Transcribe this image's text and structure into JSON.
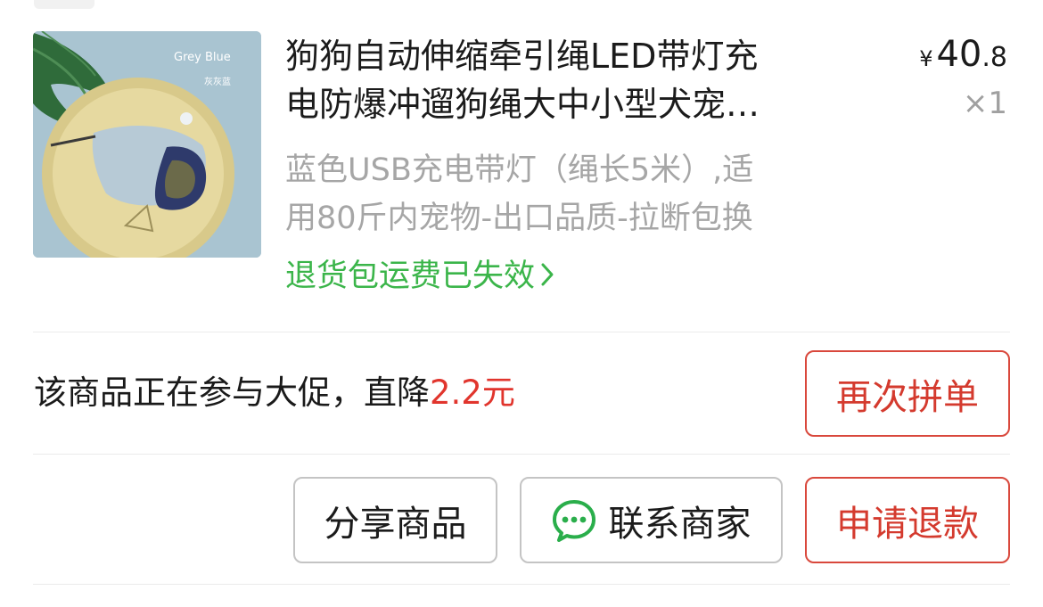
{
  "product": {
    "title_line1": "狗狗自动伸缩牵引绳LED带灯充",
    "title_line2": "电防爆冲遛狗绳大中小型犬宠…",
    "price_symbol": "¥",
    "price_int": "40",
    "price_dec": ".8",
    "quantity": "×1",
    "spec_line1": "蓝色USB充电带灯（绳长5米）,适",
    "spec_line2": "用80斤内宠物-出口品质-拉断包换",
    "return_notice": "退货包运费已失效",
    "image_text_en": "Grey Blue",
    "image_text_cn": "灰灰蓝"
  },
  "promo": {
    "text": "该商品正在参与大促，直降",
    "amount": "2.2元"
  },
  "buttons": {
    "reorder": "再次拼单",
    "share": "分享商品",
    "contact": "联系商家",
    "refund": "申请退款"
  },
  "icons": {
    "chevron": "chevron-right-icon",
    "chat": "wechat-icon"
  },
  "colors": {
    "accent_red": "#d43a2e",
    "link_green": "#3bb54a",
    "muted_text": "#a6a6a6"
  }
}
